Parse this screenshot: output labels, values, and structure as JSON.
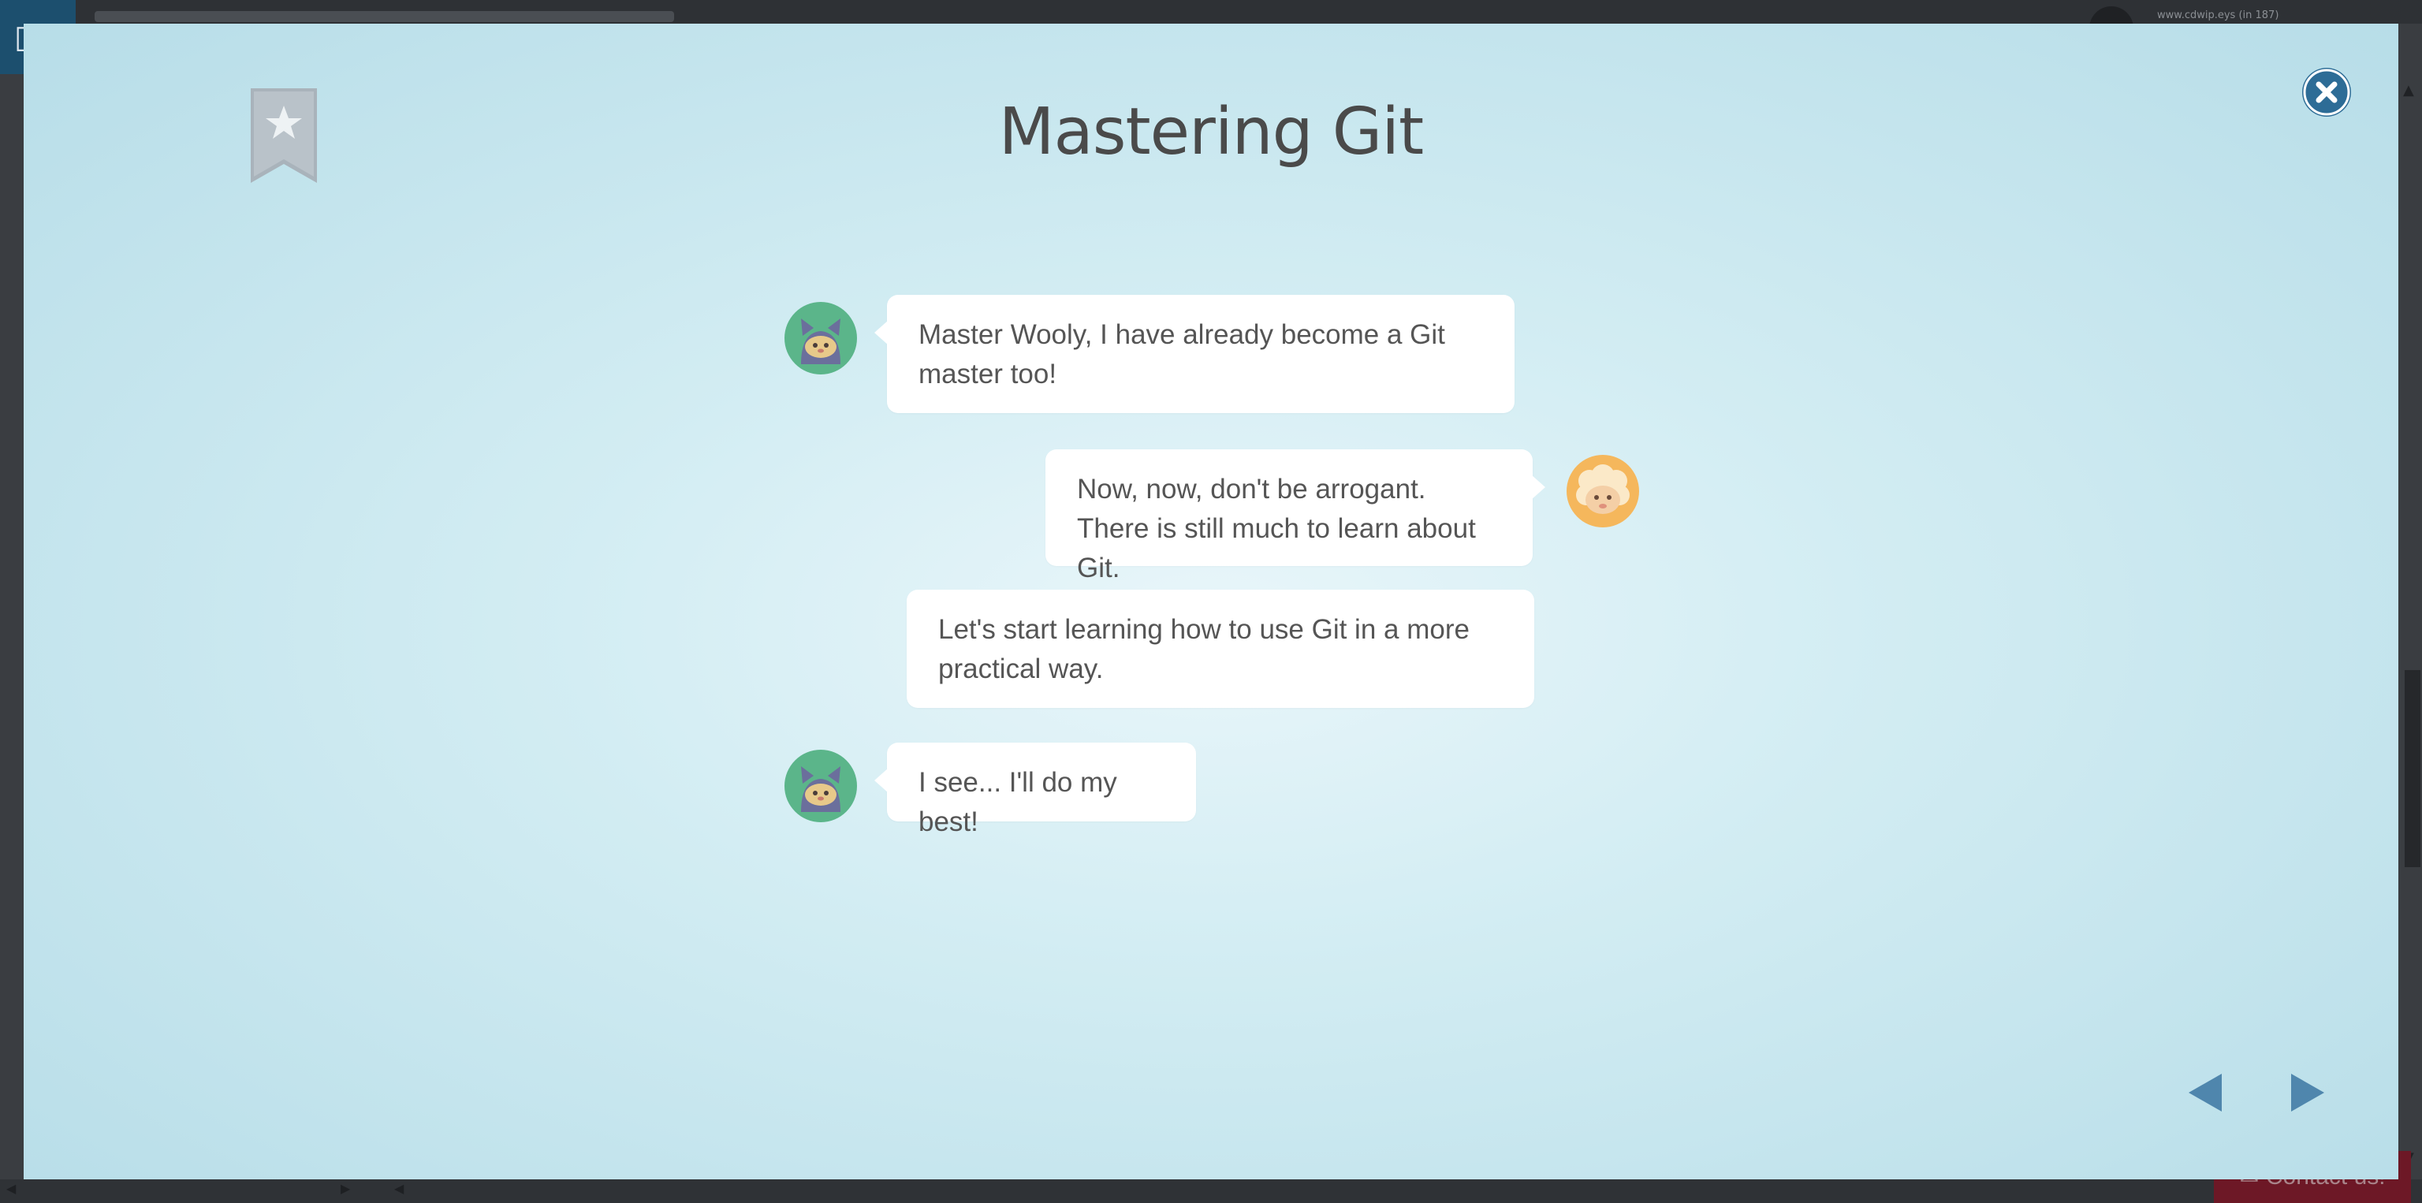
{
  "background": {
    "user_text": "www.cdwip.eys (in 187)",
    "contact_label": "Contact us!"
  },
  "modal": {
    "title": "Mastering Git",
    "messages": [
      {
        "speaker": "cat",
        "side": "left",
        "text": "Master Wooly, I have already become a Git\nmaster too!"
      },
      {
        "speaker": "sheep",
        "side": "right",
        "text": "Now, now, don't be arrogant.\nThere is still much to learn about Git."
      },
      {
        "speaker": "sheep",
        "side": "continuation",
        "text": "Let's start learning how to use Git in a more\npractical way."
      },
      {
        "speaker": "cat",
        "side": "left",
        "text": "I see... I'll do my best!"
      }
    ],
    "icons": {
      "bookmark": "bookmark-star-icon",
      "close": "close-icon",
      "prev": "triangle-left-icon",
      "next": "triangle-right-icon"
    },
    "colors": {
      "accent": "#2d6c96",
      "nav_arrow": "#4f86ad",
      "contact_bg": "#6d1826"
    }
  }
}
